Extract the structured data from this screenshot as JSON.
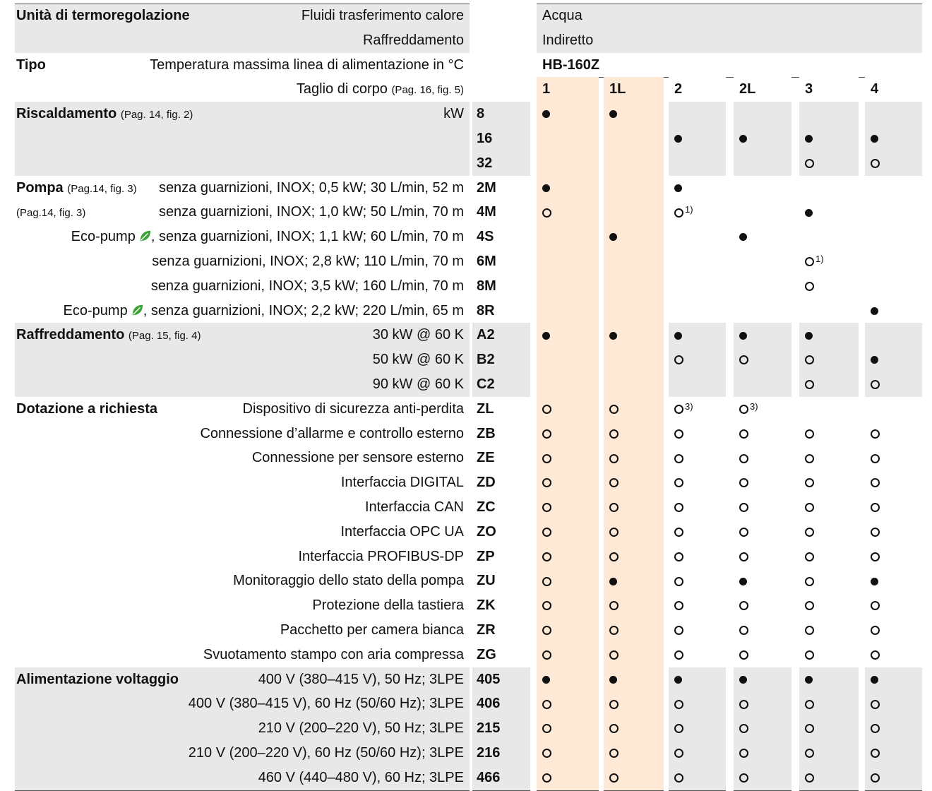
{
  "header": {
    "row1": {
      "left": "Unità di termoregolazione",
      "right": "Fluidi trasferimento calore",
      "value": "Acqua"
    },
    "row2": {
      "right": "Raffreddamento",
      "value": "Indiretto"
    },
    "row3": {
      "left": "Tipo",
      "right": "Temperatura massima linea di alimentazione in °C",
      "value": "HB-160Z"
    },
    "row4": {
      "right": "Taglio di corpo",
      "ref": "(Pag. 16, fig. 5)"
    },
    "columns": [
      "1",
      "1L",
      "2",
      "2L",
      "3",
      "4"
    ]
  },
  "legend": {
    "filled": "●",
    "open": "○"
  },
  "sections": [
    {
      "title": "Riscaldamento",
      "ref": "(Pag. 14, fig. 2)",
      "unit": "kW",
      "rows": [
        {
          "desc": "",
          "code": "8",
          "cells": [
            "F",
            "F",
            "",
            "",
            "",
            ""
          ]
        },
        {
          "desc": "",
          "code": "16",
          "cells": [
            "",
            "",
            "F",
            "F",
            "F",
            "F"
          ]
        },
        {
          "desc": "",
          "code": "32",
          "cells": [
            "",
            "",
            "",
            "",
            "O",
            "O"
          ]
        }
      ]
    },
    {
      "title": "Pompa",
      "ref": "(Pag.14, fig. 3)",
      "rows": [
        {
          "prefix": "",
          "desc": "senza guarnizioni, INOX; 0,5 kW; 30 L/min, 52 m",
          "code": "2M",
          "cells": [
            "F",
            "",
            "F",
            "",
            "",
            ""
          ]
        },
        {
          "prefix": "",
          "desc": "senza guarnizioni, INOX; 1,0 kW; 50 L/min, 70 m",
          "code": "4M",
          "cells": [
            "O",
            "",
            "O1",
            "",
            "F",
            ""
          ]
        },
        {
          "prefix": "Eco-pump",
          "desc": ", senza guarnizioni, INOX; 1,1 kW; 60 L/min, 70 m",
          "code": "4S",
          "cells": [
            "",
            "F",
            "",
            "F",
            "",
            ""
          ]
        },
        {
          "prefix": "",
          "desc": "senza guarnizioni, INOX; 2,8 kW; 110 L/min, 70 m",
          "code": "6M",
          "cells": [
            "",
            "",
            "",
            "",
            "O1",
            ""
          ]
        },
        {
          "prefix": "",
          "desc": "senza guarnizioni, INOX; 3,5 kW; 160 L/min, 70 m",
          "code": "8M",
          "cells": [
            "",
            "",
            "",
            "",
            "O",
            ""
          ]
        },
        {
          "prefix": "Eco-pump",
          "desc": ", senza guarnizioni, INOX; 2,2 kW; 220 L/min, 65 m",
          "code": "8R",
          "cells": [
            "",
            "",
            "",
            "",
            "",
            "F"
          ]
        }
      ]
    },
    {
      "title": "Raffreddamento",
      "ref": "(Pag. 15, fig. 4)",
      "rows": [
        {
          "desc": "30 kW @ 60 K",
          "code": "A2",
          "cells": [
            "F",
            "F",
            "F",
            "F",
            "F",
            ""
          ]
        },
        {
          "desc": "50 kW @ 60 K",
          "code": "B2",
          "cells": [
            "",
            "",
            "O",
            "O",
            "O",
            "F"
          ]
        },
        {
          "desc": "90 kW @ 60 K",
          "code": "C2",
          "cells": [
            "",
            "",
            "",
            "",
            "O",
            "O"
          ]
        }
      ]
    },
    {
      "title": "Dotazione a richiesta",
      "ref": "",
      "rows": [
        {
          "desc": "Dispositivo di sicurezza anti-perdita",
          "code": "ZL",
          "cells": [
            "O",
            "O",
            "O3",
            "O3",
            "",
            ""
          ]
        },
        {
          "desc": "Connessione d’allarme e controllo esterno",
          "code": "ZB",
          "cells": [
            "O",
            "O",
            "O",
            "O",
            "O",
            "O"
          ]
        },
        {
          "desc": "Connessione per sensore esterno",
          "code": "ZE",
          "cells": [
            "O",
            "O",
            "O",
            "O",
            "O",
            "O"
          ]
        },
        {
          "desc": "Interfaccia DIGITAL",
          "code": "ZD",
          "cells": [
            "O",
            "O",
            "O",
            "O",
            "O",
            "O"
          ]
        },
        {
          "desc": "Interfaccia CAN",
          "code": "ZC",
          "cells": [
            "O",
            "O",
            "O",
            "O",
            "O",
            "O"
          ]
        },
        {
          "desc": "Interfaccia OPC UA",
          "code": "ZO",
          "cells": [
            "O",
            "O",
            "O",
            "O",
            "O",
            "O"
          ]
        },
        {
          "desc": "Interfaccia PROFIBUS-DP",
          "code": "ZP",
          "cells": [
            "O",
            "O",
            "O",
            "O",
            "O",
            "O"
          ]
        },
        {
          "desc": "Monitoraggio dello stato della pompa",
          "code": "ZU",
          "cells": [
            "O",
            "F",
            "O",
            "F",
            "O",
            "F"
          ]
        },
        {
          "desc": "Protezione della tastiera",
          "code": "ZK",
          "cells": [
            "O",
            "O",
            "O",
            "O",
            "O",
            "O"
          ]
        },
        {
          "desc": "Pacchetto per camera bianca",
          "code": "ZR",
          "cells": [
            "O",
            "O",
            "O",
            "O",
            "O",
            "O"
          ]
        },
        {
          "desc": "Svuotamento stampo con aria compressa",
          "code": "ZG",
          "cells": [
            "O",
            "O",
            "O",
            "O",
            "O",
            "O"
          ]
        }
      ]
    },
    {
      "title": "Alimentazione voltaggio",
      "ref": "",
      "rows": [
        {
          "desc": "400 V (380–415 V), 50 Hz; 3LPE",
          "code": "405",
          "cells": [
            "F",
            "F",
            "F",
            "F",
            "F",
            "F"
          ]
        },
        {
          "desc": "400 V (380–415 V), 60 Hz (50/60 Hz); 3LPE",
          "code": "406",
          "cells": [
            "O",
            "O",
            "O",
            "O",
            "O",
            "O"
          ]
        },
        {
          "desc": "210 V (200–220 V), 50 Hz; 3LPE",
          "code": "215",
          "cells": [
            "O",
            "O",
            "O",
            "O",
            "O",
            "O"
          ]
        },
        {
          "desc": "210 V (200–220 V), 60 Hz (50/60 Hz); 3LPE",
          "code": "216",
          "cells": [
            "O",
            "O",
            "O",
            "O",
            "O",
            "O"
          ]
        },
        {
          "desc": "460 V (440–480 V), 60 Hz; 3LPE",
          "code": "466",
          "cells": [
            "O",
            "O",
            "O",
            "O",
            "O",
            "O"
          ]
        }
      ]
    }
  ],
  "footnotes": {
    "1": "1)",
    "3": "3)"
  },
  "colors": {
    "grey": "#e8e8e8",
    "peach": "#fde9d6",
    "leaf": "#3aa335"
  }
}
